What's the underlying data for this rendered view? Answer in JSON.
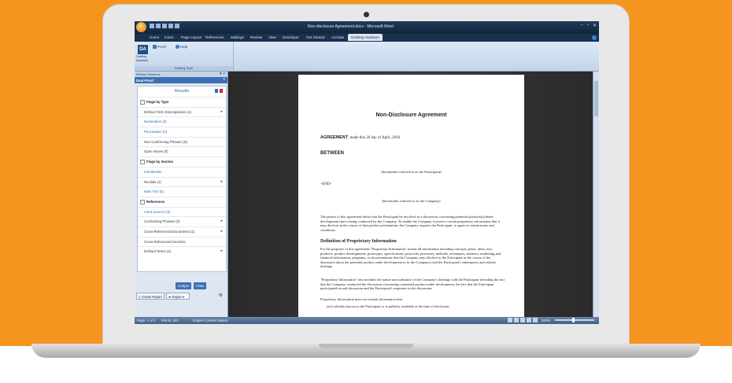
{
  "app": {
    "title": "Non-disclosure Agreement.docx - Microsoft Word",
    "window_controls": [
      "–",
      "▫",
      "✕"
    ]
  },
  "ribbon": {
    "tabs": [
      {
        "label": "Home"
      },
      {
        "label": "Insert"
      },
      {
        "label": "Page Layout"
      },
      {
        "label": "References"
      },
      {
        "label": "Mailings"
      },
      {
        "label": "Review"
      },
      {
        "label": "View"
      },
      {
        "label": "Developer"
      },
      {
        "label": "Get Started"
      },
      {
        "label": "Acrobat"
      },
      {
        "label": "Drafting Assistant"
      }
    ],
    "active_tab": "Drafting Assistant",
    "da_icon_text": "DA",
    "da_button_label": "Drafting Assistant",
    "proof_label": "Proof",
    "help_label": "Help",
    "group_label": "Drafting Tools"
  },
  "taskpane": {
    "header_title": "Review Solutions",
    "bar_title": "Deal Proof",
    "results_title": "Results",
    "rows": [
      {
        "label": "Flags by Type",
        "kind": "section",
        "toggle": "−"
      },
      {
        "label": "Defined Term Discrepancies (1)",
        "kind": "item",
        "arrow": true
      },
      {
        "label": "Numeration (0)",
        "kind": "link"
      },
      {
        "label": "Punctuation (0)",
        "kind": "link"
      },
      {
        "label": "Non-Conforming Phrases (0)",
        "kind": "item"
      },
      {
        "label": "Open Issues (0)",
        "kind": "item"
      },
      {
        "label": "Flags by Section",
        "kind": "section",
        "toggle": "−"
      },
      {
        "label": "Introduction",
        "kind": "link"
      },
      {
        "label": "Recitals (1)",
        "kind": "item",
        "arrow": true
      },
      {
        "label": "Main Text (0)",
        "kind": "link"
      },
      {
        "label": "References",
        "kind": "section",
        "toggle": "−"
      },
      {
        "label": "Cited Sources (0)",
        "kind": "link"
      },
      {
        "label": "Conforming Phrases (2)",
        "kind": "item",
        "arrow": true
      },
      {
        "label": "Cross-Referenced Documents (1)",
        "kind": "item",
        "arrow": true
      },
      {
        "label": "Cross-Referenced Sections",
        "kind": "item"
      },
      {
        "label": "Defined Terms (1)",
        "kind": "item",
        "arrow": true
      }
    ],
    "analyze_label": "Analyze",
    "close_label": "Close",
    "create_report_label": "Create Report",
    "export_label": "Export ▾"
  },
  "document": {
    "title": "Non-Disclosure Agreement",
    "agreement_label": "AGREEMENT",
    "agreement_text": ", made this 26 day of April, 2016",
    "between": "BETWEEN",
    "participant_line": "(hereinafter referred to as the Participant)",
    "and": "-AND-",
    "company_line": "(hereinafter referred to as the Company)",
    "para1": "The parties to this agreement desire that the Participant be involved in a discussion concerning potential products(s)/under development that is being conducted by the Company. To enable the Company to protect certain proprietary information that it may disclose in the course of that product presentation, the Company requires the Participant, to agree to certain terms and conditions.",
    "heading": "Definition of Proprietary Information",
    "para2": "For the purposes of this agreement \"Proprietary Information\" means all information including concepts, plans, ideas, new products, product developments, prototypes, specifications, protocols, processes, methods, techniques, business, marketing and financial information, programs, or documentation that the Company may disclose to the Participant in the course of the discussion about the potential product under development or in the Company's and the Participant's subsequent, and related, dealings.",
    "para3": "\"Proprietary Information\" also includes the nature and substance of the Company's dealings with the Participant including the fact that the Company conducted the discussion concerning a potential product under development, the fact that the Participant participated in said discussion and the Participant's responses in the discussion.",
    "para4": "Proprietary Information does not include information that:",
    "item_a": "(a)  is already known to the Participant or is publicly available at the time of disclosure;"
  },
  "status": {
    "page": "Page: 1 of 2",
    "words": "Words: 521",
    "language": "English (United States)",
    "zoom": "100%"
  },
  "colors": {
    "background": "#f5951f",
    "accent": "#3c6fb3"
  }
}
